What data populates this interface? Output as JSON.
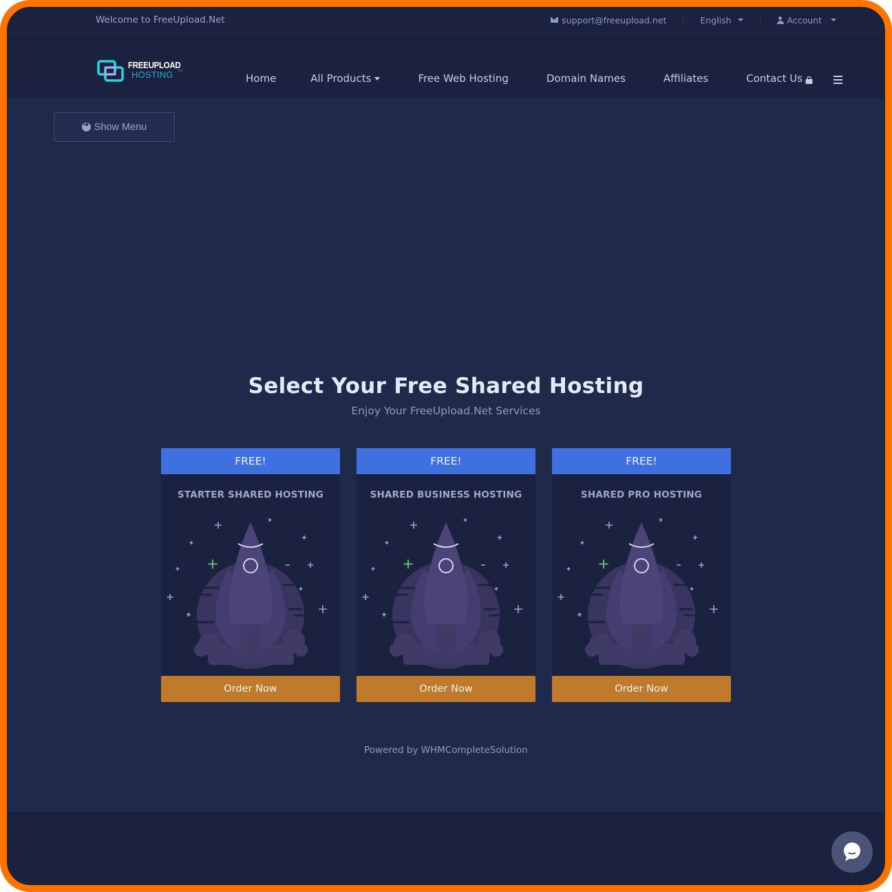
{
  "topbar": {
    "welcome": "Welcome to FreeUpload.Net",
    "email": "support@freeupload.net",
    "language": "English",
    "account": "Account"
  },
  "logo": {
    "line1": "FREEUPLOAD",
    "line2": "HOSTING",
    "tm": "TM"
  },
  "nav": {
    "items": [
      {
        "label": "Home"
      },
      {
        "label": "All Products",
        "dropdown": true
      },
      {
        "label": "Free Web Hosting"
      },
      {
        "label": "Domain Names"
      },
      {
        "label": "Affiliates"
      },
      {
        "label": "Contact Us"
      }
    ],
    "cart_icon": "shopping-bag-icon",
    "menu_icon": "hamburger-icon"
  },
  "sidebar_toggle": {
    "label": "Show Menu",
    "icon": "arrow-circle-right-icon"
  },
  "main": {
    "title": "Select Your Free Shared Hosting",
    "subtitle": "Enjoy Your FreeUpload.Net Services"
  },
  "plans": [
    {
      "badge": "FREE!",
      "name": "STARTER SHARED HOSTING",
      "button": "Order Now"
    },
    {
      "badge": "FREE!",
      "name": "SHARED BUSINESS HOSTING",
      "button": "Order Now"
    },
    {
      "badge": "FREE!",
      "name": "SHARED PRO HOSTING",
      "button": "Order Now"
    }
  ],
  "powered_by": "Powered by WHMCompleteSolution",
  "colors": {
    "frame": "#ff7300",
    "background": "#1f2a4a",
    "header": "#1b2240",
    "badge": "#4070e0",
    "order_button": "#c07a2c",
    "logo_accent": "#2ad4e0"
  },
  "chat": {
    "icon": "chat-bubble-icon"
  }
}
